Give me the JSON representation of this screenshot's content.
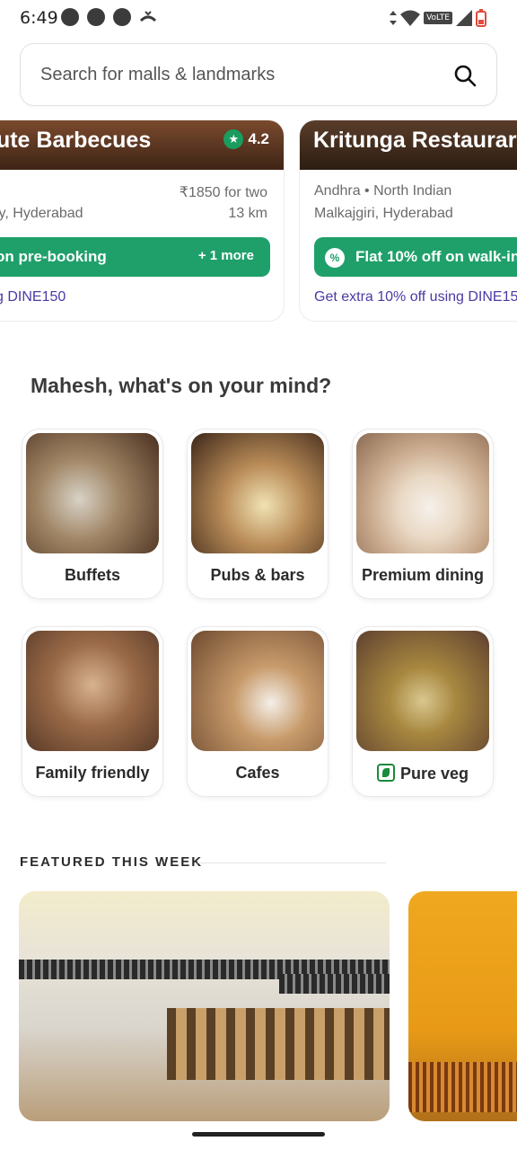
{
  "status_bar": {
    "time": "6:49",
    "network": "VoLTE"
  },
  "search": {
    "placeholder": "Search for malls & landmarks"
  },
  "restaurants": [
    {
      "name": "lute Barbecues",
      "rating": "4.2",
      "price": "₹1850 for two",
      "cuisine": "",
      "location": "ly, Hyderabad",
      "distance": "13 km",
      "offer": "on pre-booking",
      "offer_more": "+ 1 more",
      "promo": "g DINE150"
    },
    {
      "name": "Kritunga Restaurar",
      "cuisine": "Andhra • North Indian",
      "location": "Malkajgiri, Hyderabad",
      "offer": "Flat 10% off on walk-in",
      "promo": "Get extra 10% off using DINE150"
    }
  ],
  "mind_section": {
    "title": "Mahesh, what's on your mind?",
    "categories": [
      {
        "label": "Buffets"
      },
      {
        "label": "Pubs & bars"
      },
      {
        "label": "Premium dining"
      },
      {
        "label": "Family friendly"
      },
      {
        "label": "Cafes"
      },
      {
        "label": "Pure veg"
      }
    ]
  },
  "featured": {
    "title": "FEATURED THIS WEEK"
  },
  "colors": {
    "green": "#1fa06a",
    "promo_purple": "#4a3aa4",
    "veg_green": "#1a8a3b"
  },
  "icons": [
    "whatsapp-icon",
    "app-icon",
    "messenger-icon",
    "missed-call-icon",
    "wifi-icon",
    "signal-icon",
    "battery-icon",
    "search-icon",
    "star-icon",
    "percent-icon",
    "veg-icon"
  ]
}
